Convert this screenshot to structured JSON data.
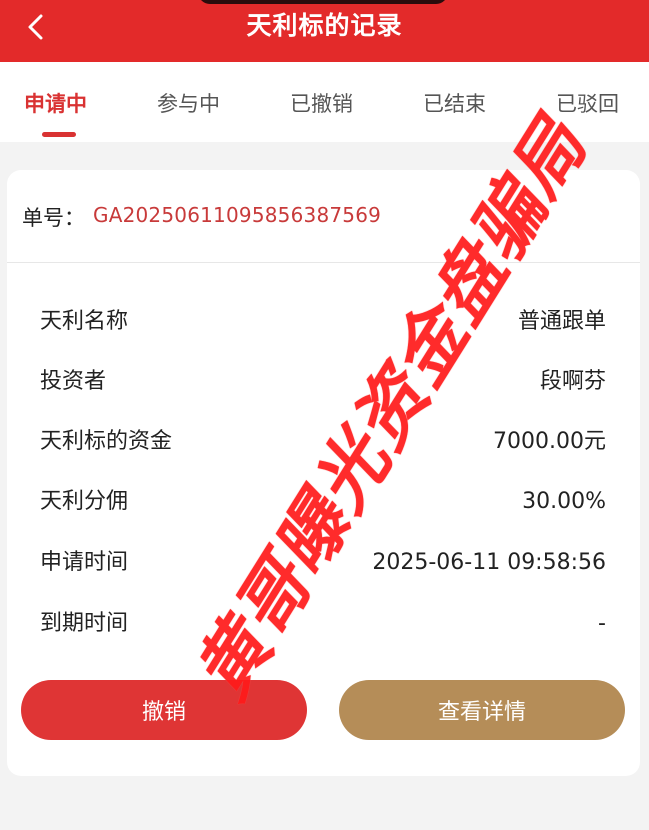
{
  "header": {
    "title": "天利标的记录"
  },
  "tabs": [
    {
      "label": "申请中"
    },
    {
      "label": "参与中"
    },
    {
      "label": "已撤销"
    },
    {
      "label": "已结束"
    },
    {
      "label": "已驳回"
    }
  ],
  "order": {
    "label": "单号：",
    "value": "GA2025061109585638756​9"
  },
  "details": [
    {
      "label": "天利名称",
      "value": "普通跟单"
    },
    {
      "label": "投资者",
      "value": "段啊芬"
    },
    {
      "label": "天利标的资金",
      "value": "7000.00元"
    },
    {
      "label": "天利分佣",
      "value": "30.00%"
    },
    {
      "label": "申请时间",
      "value": "2025-06-11 09:58:56"
    },
    {
      "label": "到期时间",
      "value": "-"
    }
  ],
  "buttons": {
    "cancel": "撤销",
    "detail": "查看详情"
  },
  "watermark": "黄哥曝光资金盘骗局",
  "colors": {
    "primary": "#e32a2a",
    "accent_gold": "#b58d58",
    "order_red": "#c83a3a"
  }
}
